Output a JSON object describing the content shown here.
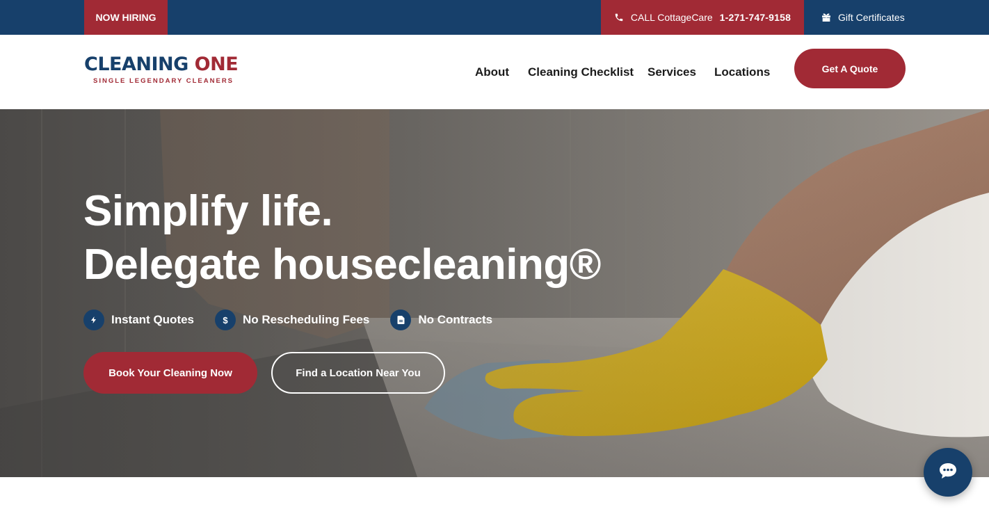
{
  "topbar": {
    "hiring_label": "NOW HIRING",
    "call_label": "CALL CottageCare",
    "phone": "1-271-747-9158",
    "gift_label": "Gift Certificates",
    "icons": {
      "phone": "phone-icon",
      "gift": "gift-icon"
    }
  },
  "header": {
    "logo": {
      "word1": "CLEANING",
      "word2": "ONE",
      "tagline": "SINGLE LEGENDARY CLEANERS"
    },
    "nav": [
      {
        "label": "About"
      },
      {
        "label": "Cleaning Checklist"
      },
      {
        "label": "Services"
      },
      {
        "label": "Locations"
      }
    ],
    "quote_button": "Get A Quote"
  },
  "hero": {
    "headline_line1": "Simplify life.",
    "headline_line2": "Delegate housecleaning®",
    "features": [
      {
        "label": "Instant Quotes",
        "icon": "bolt-icon"
      },
      {
        "label": "No Rescheduling Fees",
        "icon": "dollar-icon"
      },
      {
        "label": "No Contracts",
        "icon": "document-icon"
      }
    ],
    "primary_button": "Book Your Cleaning Now",
    "secondary_button": "Find a Location Near You"
  },
  "chat": {
    "icon": "chat-icon"
  },
  "colors": {
    "navy": "#17406b",
    "crimson": "#a12a35",
    "white": "#ffffff",
    "glove_yellow": "#d9b21f"
  }
}
